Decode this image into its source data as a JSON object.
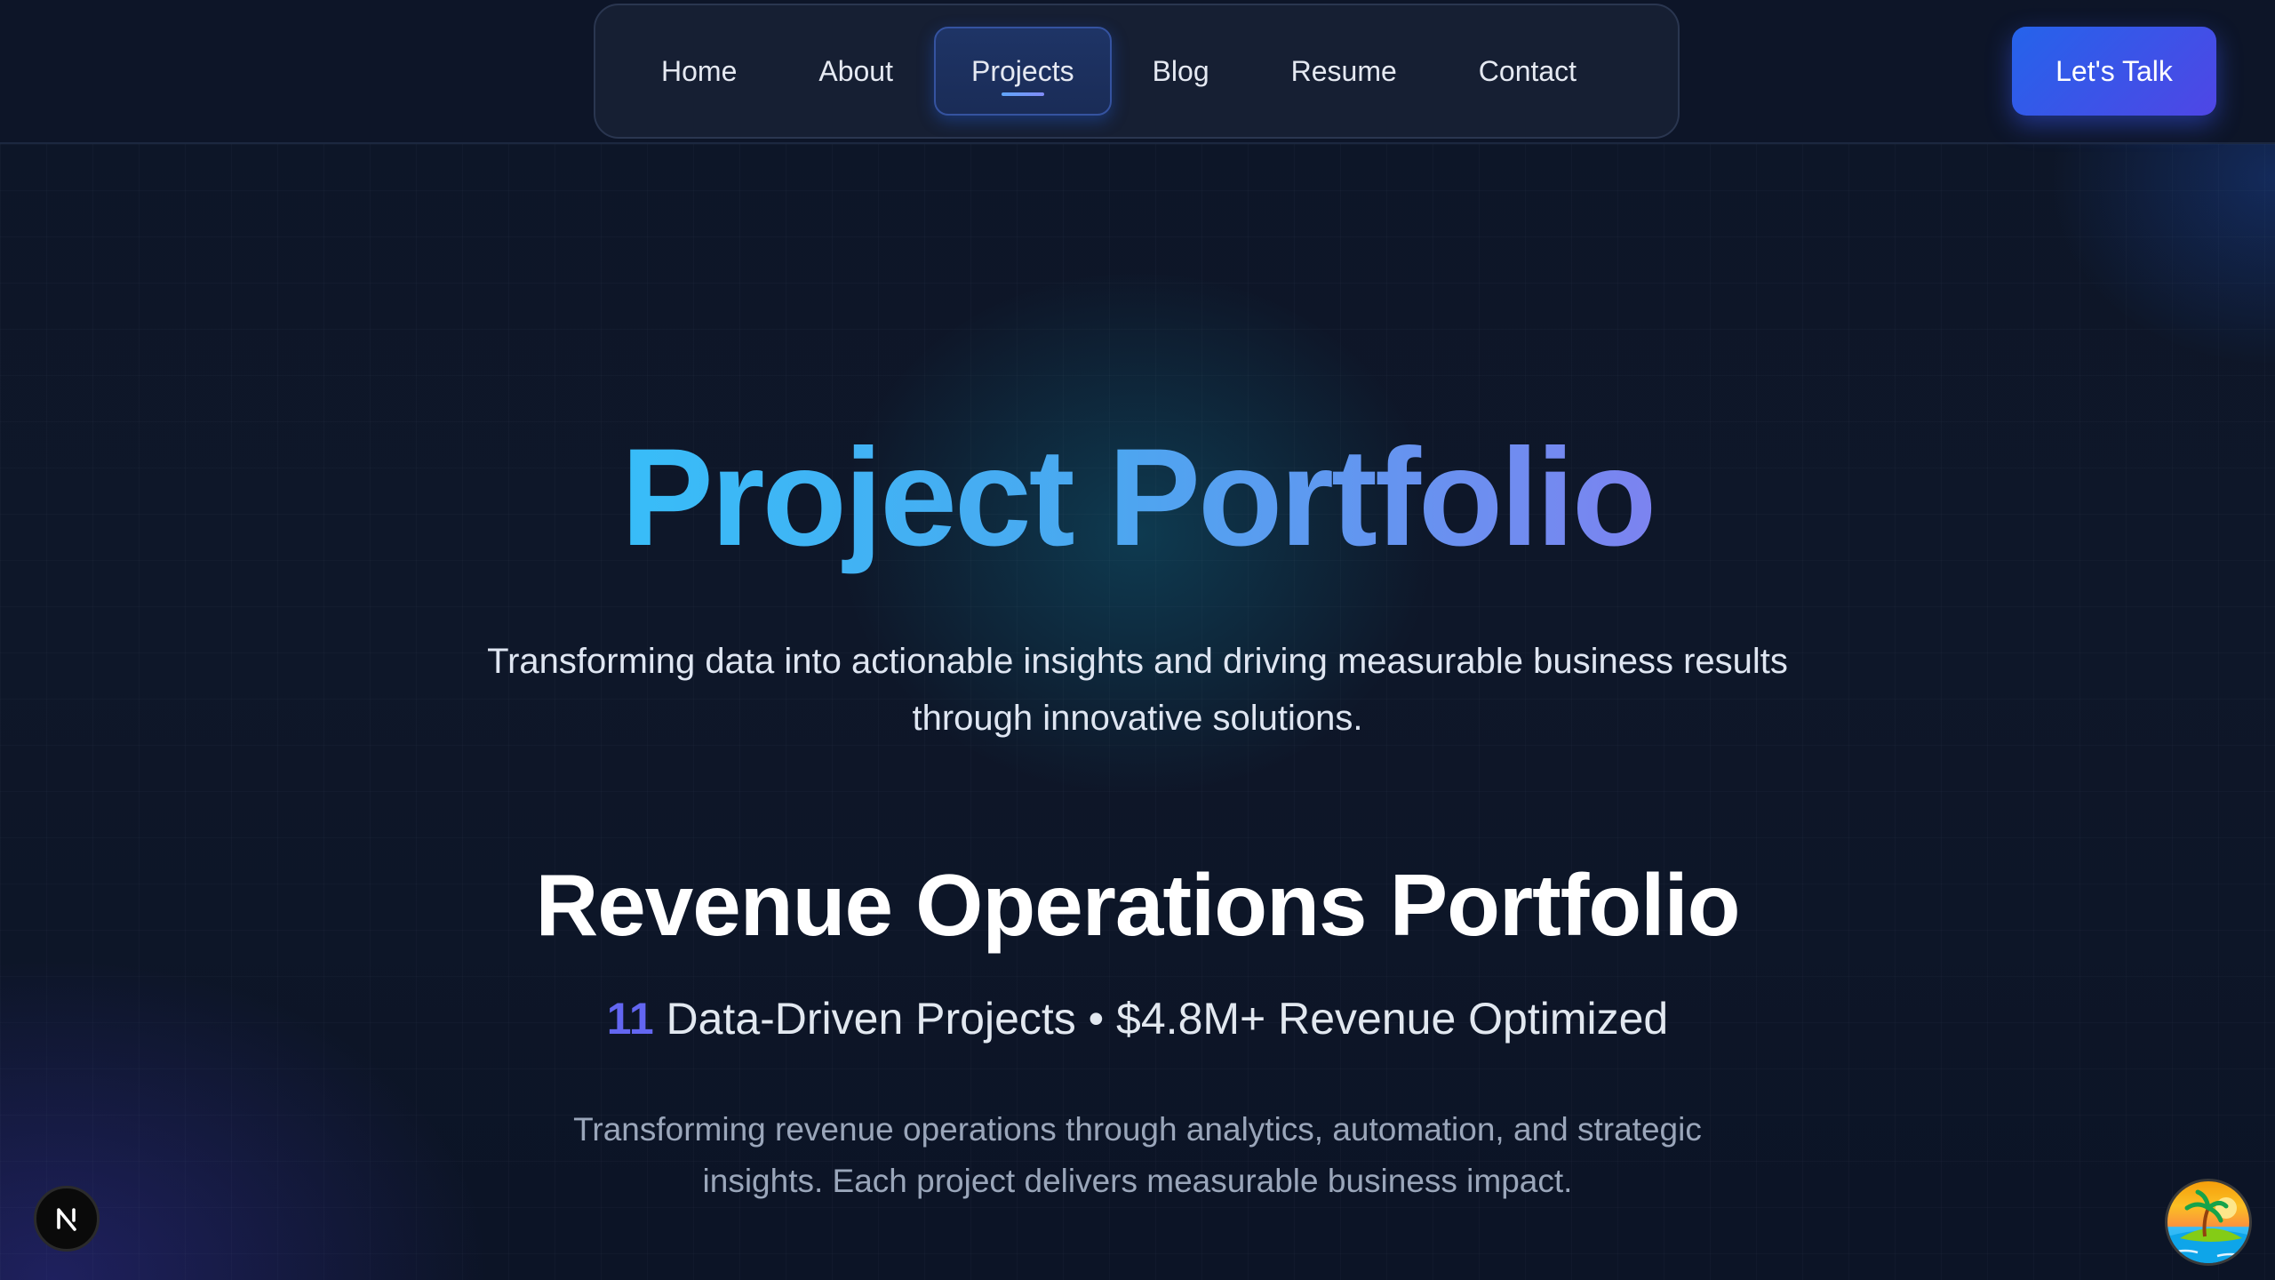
{
  "nav": {
    "items": [
      {
        "label": "Home",
        "active": false
      },
      {
        "label": "About",
        "active": false
      },
      {
        "label": "Projects",
        "active": true
      },
      {
        "label": "Blog",
        "active": false
      },
      {
        "label": "Resume",
        "active": false
      },
      {
        "label": "Contact",
        "active": false
      }
    ],
    "cta_label": "Let's Talk"
  },
  "hero": {
    "title": "Project Portfolio",
    "subtitle_line1": "Transforming data into actionable insights and driving measurable business results",
    "subtitle_line2": "through innovative solutions."
  },
  "portfolio": {
    "title": "Revenue Operations Portfolio",
    "project_count": "11",
    "stats_text": " Data-Driven Projects • $4.8M+ Revenue Optimized",
    "description_line1": "Transforming revenue operations through analytics, automation, and strategic",
    "description_line2": "insights. Each project delivers measurable business impact."
  },
  "widgets": {
    "dev_badge_icon": "nextjs-n-icon",
    "island_icon": "tropical-island-icon"
  },
  "colors": {
    "background": "#0c1426",
    "accent": "#2563eb",
    "count_accent": "#6366f1",
    "title_gradient_start": "#38bdf8",
    "title_gradient_end": "#7c83f0"
  }
}
